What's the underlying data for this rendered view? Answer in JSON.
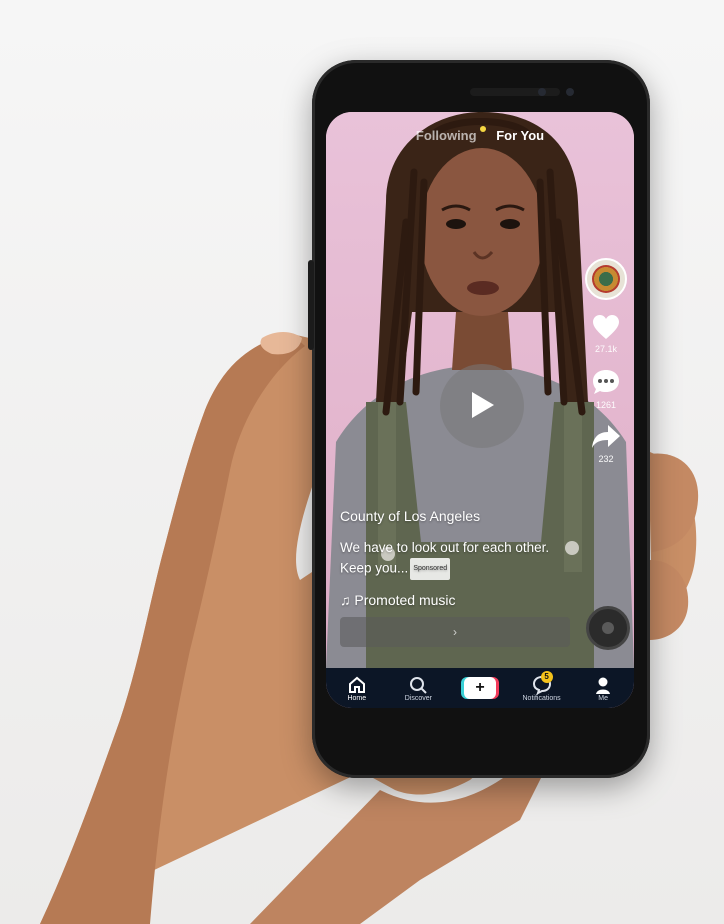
{
  "tabs": {
    "following": "Following",
    "for_you": "For You"
  },
  "rail": {
    "likes": "27.1k",
    "comments": "1261",
    "shares": "232"
  },
  "post": {
    "author": "County of Los Angeles",
    "description": "We have to look out for each other. Keep you...",
    "sponsored": "Sponsored",
    "music": "♫ Promoted music",
    "cta_arrow": "›"
  },
  "nav": {
    "home": "Home",
    "discover": "Discover",
    "notifications": "Notifications",
    "notification_count": "5",
    "me": "Me"
  }
}
